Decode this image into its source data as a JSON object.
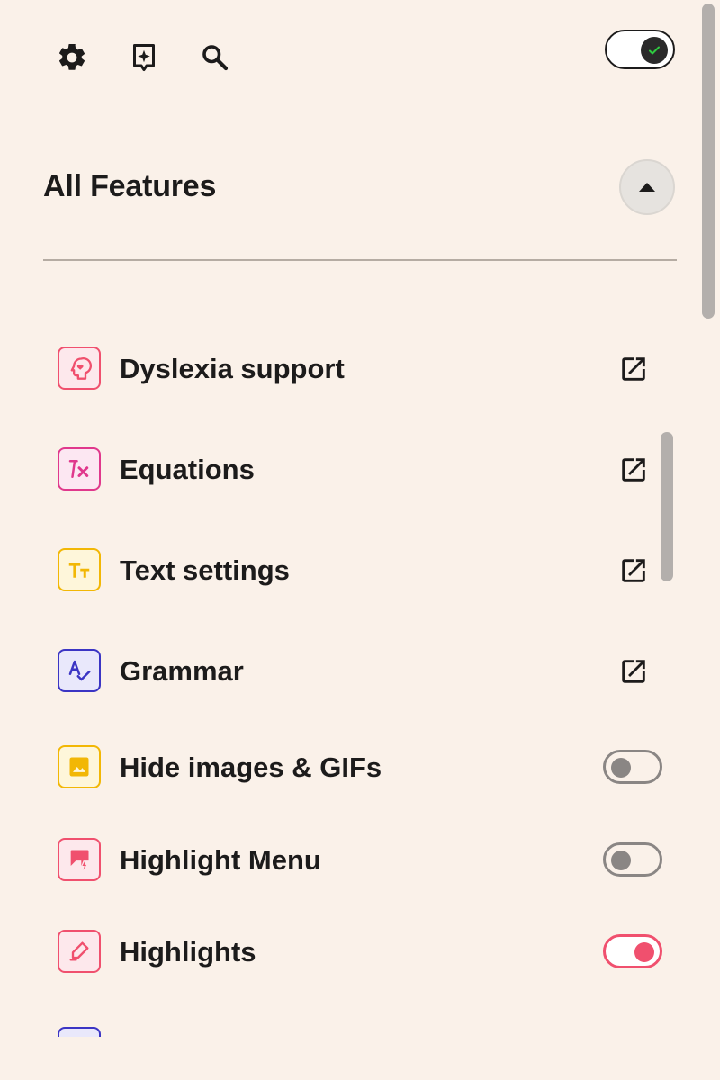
{
  "toolbar": {
    "settings_icon": "gear-icon",
    "assistant_icon": "sparkle-bookmark-icon",
    "search_icon": "search-icon",
    "master_toggle_state": "on"
  },
  "section": {
    "title": "All Features",
    "collapse_icon": "triangle-up-icon"
  },
  "features": [
    {
      "label": "Dyslexia support",
      "icon": "head-heart-icon",
      "color": "#f0506e",
      "bg": "#fde8ec",
      "control": "external-link"
    },
    {
      "label": "Equations",
      "icon": "function-icon",
      "color": "#e0388c",
      "bg": "#fce7f2",
      "control": "external-link"
    },
    {
      "label": "Text settings",
      "icon": "text-size-icon",
      "color": "#f2b705",
      "bg": "#fef6da",
      "control": "external-link"
    },
    {
      "label": "Grammar",
      "icon": "spellcheck-icon",
      "color": "#3b35c4",
      "bg": "#e9e8fb",
      "control": "external-link"
    },
    {
      "label": "Hide images & GIFs",
      "icon": "image-icon",
      "color": "#f2b705",
      "bg": "#fef6da",
      "control": "toggle",
      "toggle_on": false
    },
    {
      "label": "Highlight Menu",
      "icon": "chat-flash-icon",
      "color": "#f0506e",
      "bg": "#fde8ec",
      "control": "toggle",
      "toggle_on": false
    },
    {
      "label": "Highlights",
      "icon": "highlighter-icon",
      "color": "#f0506e",
      "bg": "#fde8ec",
      "control": "toggle",
      "toggle_on": true
    },
    {
      "label": "",
      "icon": "partial-icon",
      "color": "#3b35c4",
      "bg": "#e9e8fb",
      "control": "none"
    }
  ]
}
